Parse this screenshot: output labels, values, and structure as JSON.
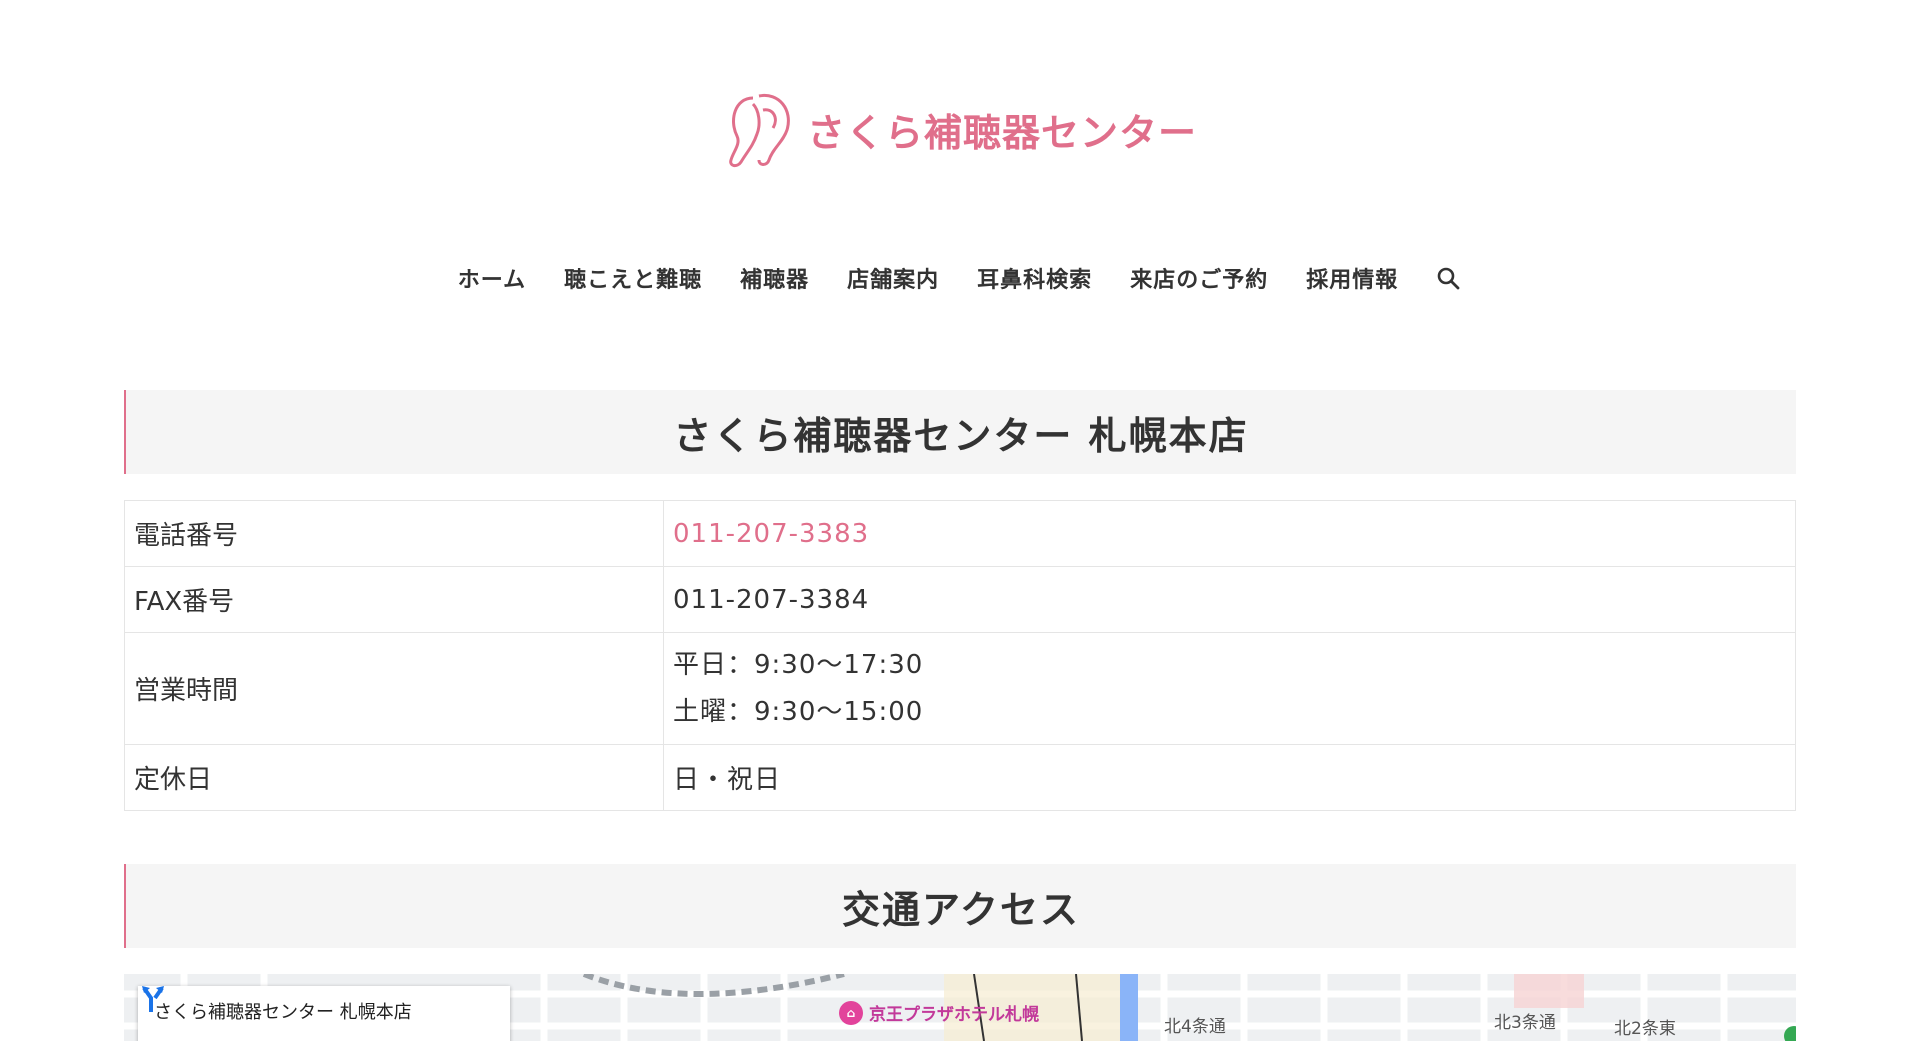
{
  "header": {
    "logo_text": "さくら補聴器センター"
  },
  "nav": {
    "items": [
      {
        "label": "ホーム"
      },
      {
        "label": "聴こえと難聴"
      },
      {
        "label": "補聴器"
      },
      {
        "label": "店舗案内"
      },
      {
        "label": "耳鼻科検索"
      },
      {
        "label": "来店のご予約"
      },
      {
        "label": "採用情報"
      }
    ],
    "search_icon": "search-icon"
  },
  "store": {
    "title": "さくら補聴器センター 札幌本店"
  },
  "info": {
    "phone_label": "電話番号",
    "phone_value": "011-207-3383",
    "fax_label": "FAX番号",
    "fax_value": "011-207-3384",
    "hours_label": "営業時間",
    "hours_weekday": "平日：9:30〜17:30",
    "hours_saturday": "土曜：9:30〜15:00",
    "closed_label": "定休日",
    "closed_value": "日・祝日"
  },
  "access": {
    "title": "交通アクセス"
  },
  "map": {
    "card_title": "さくら補聴器センター 札幌本店",
    "hotel_label": "京王プラザホテル札幌",
    "street_1": "北4条通",
    "street_2": "北3条通",
    "street_3": "北2条東"
  },
  "colors": {
    "accent": "#e06f8b",
    "heading_bg": "#f5f5f5",
    "text": "#333333"
  }
}
